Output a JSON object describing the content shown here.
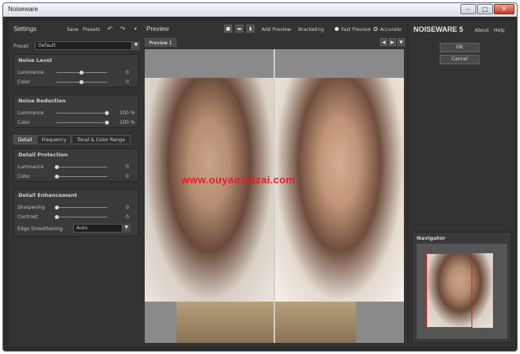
{
  "window": {
    "title": "Noiseware"
  },
  "settings": {
    "title": "Settings",
    "save_label": "Save",
    "presets_label": "Presets",
    "preset_label": "Preset",
    "preset_value": "Default",
    "noise_level": {
      "title": "Noise Level",
      "sliders": [
        {
          "label": "Luminance",
          "value": "0",
          "fraction": 0.5
        },
        {
          "label": "Color",
          "value": "0",
          "fraction": 0.5
        }
      ]
    },
    "noise_reduction": {
      "title": "Noise Reduction",
      "sliders": [
        {
          "label": "Luminance",
          "value": "100",
          "unit": "%",
          "fraction": 1.0
        },
        {
          "label": "Color",
          "value": "100",
          "unit": "%",
          "fraction": 1.0
        }
      ]
    },
    "tabs": [
      "Detail",
      "Frequency",
      "Tonal & Color Range"
    ],
    "detail_protection": {
      "title": "Detail Protection",
      "sliders": [
        {
          "label": "Luminance",
          "value": "0",
          "fraction": 0.0
        },
        {
          "label": "Color",
          "value": "0",
          "fraction": 0.0
        }
      ]
    },
    "detail_enhancement": {
      "title": "Detail Enhancement",
      "sliders": [
        {
          "label": "Sharpening",
          "value": "0",
          "fraction": 0.0
        },
        {
          "label": "Contrast",
          "value": "0",
          "fraction": 0.0
        }
      ],
      "edge_label": "Edge Smoothening",
      "edge_value": "Auto"
    }
  },
  "preview": {
    "title": "Preview",
    "add_preview_label": "Add Preview",
    "bracketing_label": "Bracketing",
    "fast_preview_label": "Fast Preview",
    "accurate_label": "Accurate",
    "tab_label": "Preview 1",
    "watermark": "www.ouyaoxiazai.com"
  },
  "right_panel": {
    "brand": "NOISEWARE 5",
    "about_label": "About",
    "help_label": "Help",
    "ok_label": "OK",
    "cancel_label": "Cancel",
    "navigator_title": "Navigator"
  },
  "colors": {
    "panel_bg": "#333333",
    "watermark": "#e0202a",
    "navigator_frame": "#e02020"
  }
}
